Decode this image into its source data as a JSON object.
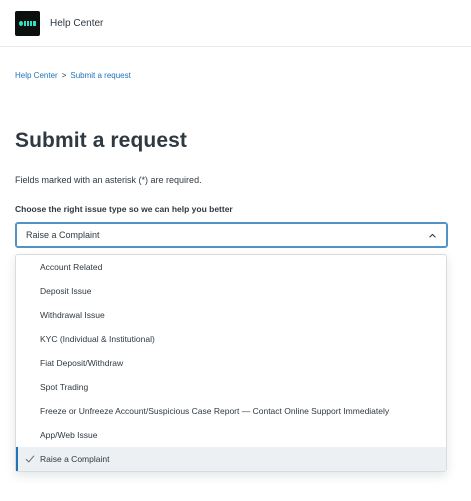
{
  "header": {
    "title": "Help Center"
  },
  "breadcrumb": {
    "items": [
      "Help Center",
      "Submit a request"
    ],
    "separator": ">"
  },
  "page": {
    "title": "Submit a request",
    "required_note": "Fields marked with an asterisk (*) are required."
  },
  "issue_type": {
    "label": "Choose the right issue type so we can help you better",
    "selected": "Raise a Complaint",
    "options": [
      "Account Related",
      "Deposit Issue",
      "Withdrawal Issue",
      "KYC (Individual & Institutional)",
      "Fiat Deposit/Withdraw",
      "Spot Trading",
      "Freeze or Unfreeze Account/Suspicious Case Report — Contact Online Support Immediately",
      "App/Web Issue",
      "Raise a Complaint"
    ]
  },
  "colors": {
    "accent": "#1f73b7",
    "focus_border": "#5293c7",
    "text": "#2f3941",
    "logo_bg": "#0b0f0e",
    "logo_mark": "#2fe0c2",
    "selected_bg": "#edf0f2"
  },
  "icons": {
    "logo": "brand-logo",
    "chevron": "chevron-up-icon",
    "check": "check-icon"
  }
}
